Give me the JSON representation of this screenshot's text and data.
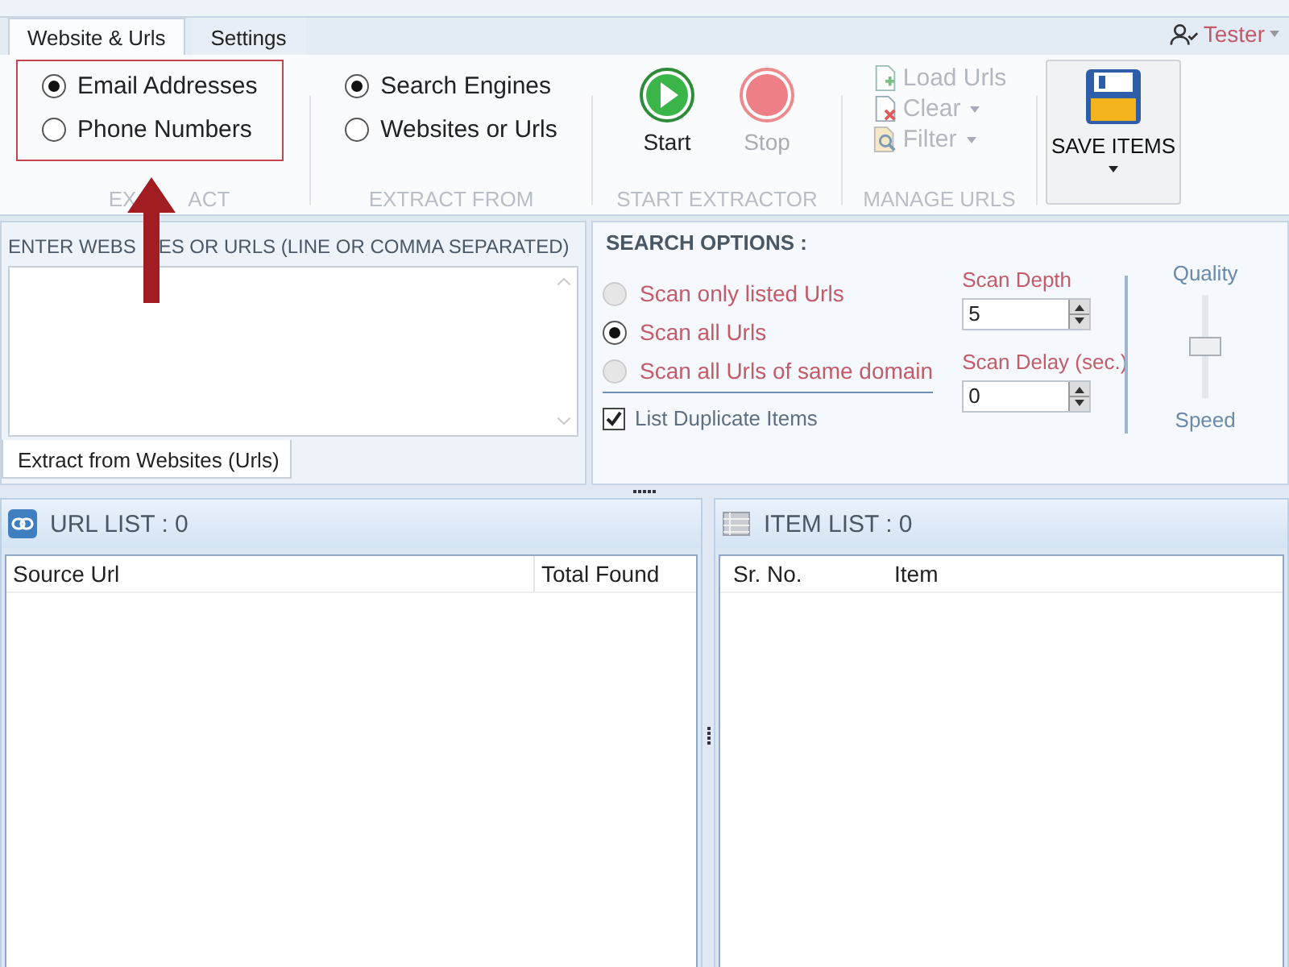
{
  "tabs": [
    {
      "label": "Website & Urls",
      "selected": true
    },
    {
      "label": "Settings",
      "selected": false
    }
  ],
  "user": {
    "name": "Tester",
    "dropdown": true
  },
  "ribbon": {
    "extract": {
      "label_parts": [
        "EX",
        "ACT"
      ],
      "highlighted": true,
      "options": [
        {
          "label": "Email Addresses",
          "selected": true
        },
        {
          "label": "Phone Numbers",
          "selected": false
        }
      ]
    },
    "extract_from": {
      "label": "EXTRACT FROM",
      "options": [
        {
          "label": "Search Engines",
          "selected": true
        },
        {
          "label": "Websites or Urls",
          "selected": false
        }
      ]
    },
    "start_extractor": {
      "label": "START EXTRACTOR",
      "buttons": [
        {
          "kind": "start",
          "label": "Start",
          "disabled": false
        },
        {
          "kind": "stop",
          "label": "Stop",
          "disabled": true
        }
      ]
    },
    "manage_urls": {
      "label": "MANAGE URLS",
      "buttons": [
        {
          "kind": "load",
          "label": "Load Urls",
          "dropdown": false,
          "disabled": true
        },
        {
          "kind": "clear",
          "label": "Clear",
          "dropdown": true,
          "disabled": true
        },
        {
          "kind": "filter",
          "label": "Filter",
          "dropdown": true,
          "disabled": true
        }
      ]
    },
    "save": {
      "label": "SAVE ITEMS",
      "dropdown": true
    }
  },
  "input_panel": {
    "header_parts": [
      "ENTER WEBS",
      "ES OR URLS (LINE OR COMMA SEPARATED)"
    ],
    "tab": "Extract from Websites (Urls)"
  },
  "search_options": {
    "header": "SEARCH OPTIONS :",
    "scan_modes": [
      {
        "label": "Scan only listed Urls",
        "selected": false,
        "disabled": true
      },
      {
        "label": "Scan all Urls",
        "selected": true,
        "disabled": false
      },
      {
        "label": "Scan all Urls of same domain",
        "selected": false,
        "disabled": true
      }
    ],
    "list_duplicates": {
      "label": "List Duplicate Items",
      "checked": true
    },
    "scan_depth": {
      "label": "Scan Depth",
      "value": "5"
    },
    "scan_delay": {
      "label": "Scan Delay (sec.)",
      "value": "0"
    },
    "quality_slider": {
      "top_label": "Quality",
      "bottom_label": "Speed",
      "level": 0.5
    }
  },
  "url_list": {
    "title": "URL LIST : 0",
    "columns": [
      "Source Url",
      "Total Found"
    ]
  },
  "item_list": {
    "title": "ITEM LIST : 0",
    "columns": [
      "Sr. No.",
      "Item"
    ]
  }
}
